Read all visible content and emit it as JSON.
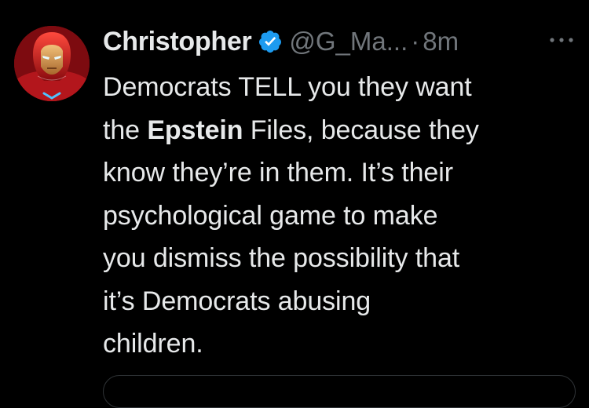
{
  "author": {
    "name": "Christopher",
    "handle": "@G_Ma...",
    "separator": "·",
    "timestamp": "8m",
    "verified": true,
    "verified_color": "#1d9bf0",
    "avatar_icon": "iron-man-helmet-icon"
  },
  "tweet": {
    "lines": [
      {
        "parts": [
          {
            "text": "Democrats TELL you they want",
            "bold": false
          }
        ]
      },
      {
        "parts": [
          {
            "text": "the ",
            "bold": false
          },
          {
            "text": "Epstein",
            "bold": true
          },
          {
            "text": " Files, because they",
            "bold": false
          }
        ]
      },
      {
        "parts": [
          {
            "text": "know they’re in them.  It’s their",
            "bold": false
          }
        ]
      },
      {
        "parts": [
          {
            "text": "psychological game to make",
            "bold": false
          }
        ]
      },
      {
        "parts": [
          {
            "text": "you dismiss the possibility that",
            "bold": false
          }
        ]
      },
      {
        "parts": [
          {
            "text": "it’s Democrats abusing",
            "bold": false
          }
        ]
      },
      {
        "parts": [
          {
            "text": "children.",
            "bold": false
          }
        ]
      }
    ]
  },
  "colors": {
    "background": "#000000",
    "primary_text": "#e7e9ea",
    "secondary_text": "#71767b",
    "accent": "#1d9bf0"
  }
}
